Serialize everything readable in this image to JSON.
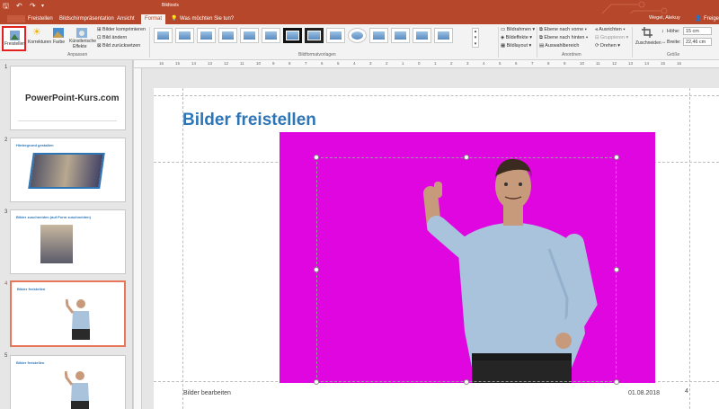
{
  "quick_access": {
    "save": "🖫",
    "undo": "↶",
    "redo": "↷",
    "customize": "▾"
  },
  "title_bar": {
    "context_group": "Bildtools",
    "user": "Wegel, Alekuy",
    "share": "Freigeb"
  },
  "tabs": [
    "Freistellen",
    "Bildschirmpräsentation",
    "Ansicht",
    "Format"
  ],
  "active_tab": "Format",
  "tell_me": "Was möchten Sie tun?",
  "ribbon": {
    "freistellen_btn": "Freistellen",
    "korrekturen": "Korrekturen",
    "farbe": "Farbe",
    "kuenstlerisch": [
      "Künstlerische",
      "Effekte"
    ],
    "bilder_komprimieren": "Bilder komprimieren",
    "bild_aendern": "Bild ändern",
    "bild_zuruecksetzen": "Bild zurücksetzen",
    "group_anpassen": "Anpassen",
    "group_bildformatvorlagen": "Bildformatvorlagen",
    "bildrahmen": "Bildrahmen",
    "bildeffekte": "Bildeffekte",
    "bildlayout": "Bildlayout",
    "ebene_vorne": "Ebene nach vorne",
    "ebene_hinten": "Ebene nach hinten",
    "auswahlbereich": "Auswahlbereich",
    "ausrichten": "Ausrichten",
    "gruppieren": "Gruppieren",
    "drehen": "Drehen",
    "group_anordnen": "Anordnen",
    "zuschneiden": "Zuschneiden",
    "hoehe_label": "Höhe:",
    "hoehe_value": "15 cm",
    "breite_label": "Breite:",
    "breite_value": "22,46 cm",
    "group_groesse": "Größe"
  },
  "ruler_numbers": [
    "16",
    "15",
    "14",
    "13",
    "12",
    "11",
    "10",
    "9",
    "8",
    "7",
    "6",
    "5",
    "4",
    "3",
    "2",
    "1",
    "0",
    "1",
    "2",
    "3",
    "4",
    "5",
    "6",
    "7",
    "8",
    "9",
    "10",
    "11",
    "12",
    "13",
    "14",
    "15",
    "16"
  ],
  "slides": [
    {
      "num": "1",
      "title": "PowerPoint-Kurs.com"
    },
    {
      "num": "2",
      "title": "Hintergrund gestalten"
    },
    {
      "num": "3",
      "title": "Bilder zuschneiden (auf Form zuschneiden)"
    },
    {
      "num": "4",
      "title": "Bilder freistellen"
    },
    {
      "num": "5",
      "title": "Bilder freistellen"
    }
  ],
  "selected_slide": "4",
  "slide": {
    "title": "Bilder freistellen",
    "footer": "Bilder bearbeiten",
    "date": "01.08.2018",
    "number": "4"
  },
  "colors": {
    "accent": "#b7472a",
    "title": "#2e75b6",
    "magenta": "#e006e0",
    "selection": "#e8765a"
  }
}
